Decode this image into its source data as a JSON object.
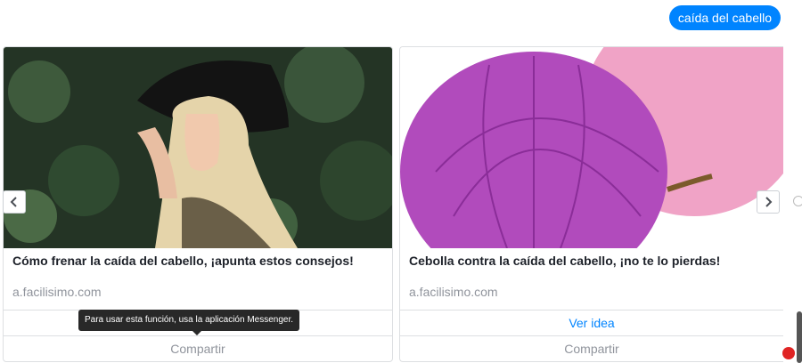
{
  "user_message": "caída del cabello",
  "cards": [
    {
      "title": "Cómo frenar la caída del cabello, ¡apunta estos consejos!",
      "source": "a.facilisimo.com",
      "share_label": "Compartir"
    },
    {
      "title": "Cebolla contra la caída del cabello, ¡no te lo pierdas!",
      "source": "a.facilisimo.com",
      "view_label": "Ver idea",
      "share_label": "Compartir"
    }
  ],
  "tooltip": "Para usar esta función, usa la aplicación Messenger.",
  "icons": {
    "prev": "chevron-left-icon",
    "next": "chevron-right-icon"
  },
  "colors": {
    "accent": "#0084ff",
    "muted": "#90949c"
  }
}
